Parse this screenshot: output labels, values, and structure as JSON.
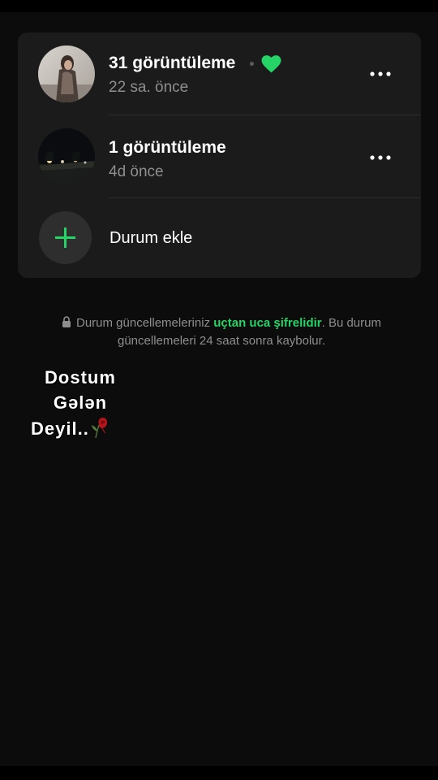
{
  "statuses": [
    {
      "views": "31 görüntüleme",
      "time": "22 sa. önce",
      "reaction": "heart-icon",
      "avatar": "woman-photo-thumbnail"
    },
    {
      "views": "1 görüntüleme",
      "time": "4d önce",
      "avatar": "night-street-photo-thumbnail"
    }
  ],
  "add_status": {
    "label": "Durum ekle"
  },
  "notice": {
    "before": "Durum güncellemeleriniz ",
    "link": "uçtan uca şifrelidir",
    "after": ". Bu durum güncellemeleri 24 saat sonra kaybolur."
  },
  "sticker": {
    "line1": "Dostum",
    "line2": "Gələn",
    "line3": "Deyil..",
    "decoration": "wilted-rose-icon"
  },
  "colors": {
    "accent": "#25d366",
    "background": "#0c0c0c",
    "card": "#1b1b1b"
  }
}
